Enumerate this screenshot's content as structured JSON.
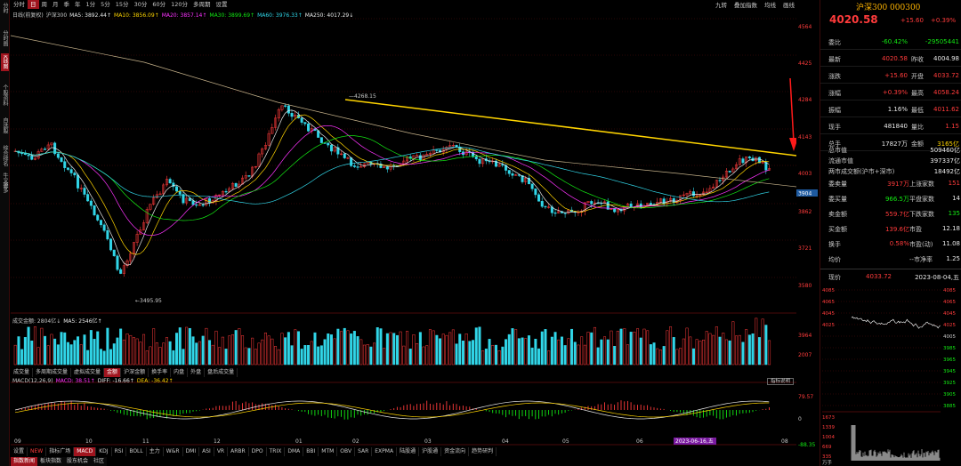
{
  "left_bar": [
    "分时",
    "分时图",
    "K线图",
    "个股资料",
    "自选股",
    "综合排名",
    "牛叉诊断",
    "更多"
  ],
  "period_tabs": [
    "分时",
    "日",
    "周",
    "月",
    "季",
    "年",
    "1分",
    "5分",
    "15分",
    "30分",
    "60分",
    "120分",
    "多周期",
    "设置"
  ],
  "period_active": 1,
  "toolbar_right": [
    "九转",
    "叠加指数",
    "均线",
    "画线"
  ],
  "ma_legend": [
    {
      "text": "日线(前复权)",
      "color": "#c8c8c8"
    },
    {
      "text": "沪深300",
      "color": "#c8c8c8"
    },
    {
      "text": "MA5: 3892.44↑",
      "color": "#e8e8e8"
    },
    {
      "text": "MA10: 3856.09↑",
      "color": "#ffd400"
    },
    {
      "text": "MA20: 3857.14↑",
      "color": "#ff33ff"
    },
    {
      "text": "MA30: 3899.69↑",
      "color": "#13e813"
    },
    {
      "text": "MA60: 3976.33↑",
      "color": "#31d6e8"
    },
    {
      "text": "MA250: 4017.29↓",
      "color": "#e8e8e8"
    }
  ],
  "price_axis": [
    "4564",
    "4425",
    "4284",
    "4143",
    "4003",
    "3862",
    "3721",
    "3580"
  ],
  "price_tags": {
    "current": "4003",
    "highlight": "3904"
  },
  "annotations": {
    "high": "4268.15",
    "low": "3495.95"
  },
  "vol_legend": [
    {
      "text": "成交金额: 2804亿↓",
      "color": "#c8c8c8"
    },
    {
      "text": "MA5: 2546亿↑",
      "color": "#e8e8e8"
    }
  ],
  "vol_axis": [
    "3964",
    "2007"
  ],
  "bottom_tabs_1": [
    "成交量",
    "多周期成交量",
    "虚拟成交量",
    "金额",
    "沪深金额",
    "换手率",
    "内盘",
    "外盘",
    "盘后成交量"
  ],
  "bottom_tabs_1_active": 3,
  "macd_legend": [
    {
      "text": "MACD(12,26,9)",
      "color": "#c8c8c8"
    },
    {
      "text": "MACD: 38.51↑",
      "color": "#ff33ff"
    },
    {
      "text": "DIFF: -16.66↑",
      "color": "#e8e8e8"
    },
    {
      "text": "DEA: -36.42↑",
      "color": "#ffd400"
    }
  ],
  "macd_axis": [
    "79.57",
    "0",
    "-88.35"
  ],
  "indicator_btn": "指标说明",
  "date_axis": [
    "09",
    "10",
    "11",
    "12",
    "01",
    "02",
    "03",
    "04",
    "05",
    "06",
    "07",
    "08"
  ],
  "date_highlight": "2023-06-16,五",
  "bottom_tabs_2": [
    "设置",
    "NEW",
    "指标广场",
    "MACD",
    "KDJ",
    "RSI",
    "BOLL",
    "主力",
    "W&R",
    "DMI",
    "ASI",
    "VR",
    "ARBR",
    "DPO",
    "TRIX",
    "DMA",
    "BBI",
    "MTM",
    "OBV",
    "SAR",
    "EXPMA",
    "陆股通",
    "沪股通",
    "资金流向",
    "趋势研判"
  ],
  "bottom_tabs_2_active": 3,
  "bottom_tabs_3": [
    "指数新闻",
    "板块指数",
    "股东机会",
    "社区"
  ],
  "bottom_tabs_3_active": 0,
  "quote": {
    "title": "沪深300 000300",
    "price": "4020.58",
    "change": "+15.60",
    "pct": "+0.39%",
    "rows": [
      {
        "k1": "委比",
        "v1": "-60.42%",
        "c1": "green",
        "k2": "",
        "v2": "-29505441",
        "c2": "green"
      },
      {
        "k1": "最新",
        "v1": "4020.58",
        "c1": "red",
        "k2": "昨收",
        "v2": "4004.98",
        "c2": "white"
      },
      {
        "k1": "涨跌",
        "v1": "+15.60",
        "c1": "red",
        "k2": "开盘",
        "v2": "4033.72",
        "c2": "red"
      },
      {
        "k1": "涨幅",
        "v1": "+0.39%",
        "c1": "red",
        "k2": "最高",
        "v2": "4058.24",
        "c2": "red"
      },
      {
        "k1": "振幅",
        "v1": "1.16%",
        "c1": "white",
        "k2": "最低",
        "v2": "4011.62",
        "c2": "red"
      },
      {
        "k1": "现手",
        "v1": "481840",
        "c1": "white",
        "k2": "量比",
        "v2": "1.15",
        "c2": "red"
      },
      {
        "k1": "总手",
        "v1": "17827万",
        "c1": "white",
        "k2": "金额",
        "v2": "3165亿",
        "c2": "yellow"
      }
    ],
    "section2": [
      {
        "k": "总市值",
        "v": "",
        "k2": "",
        "v2": "509460亿",
        "c": "white"
      },
      {
        "k": "流通市值",
        "v": "",
        "k2": "",
        "v2": "397337亿",
        "c": "white"
      },
      {
        "k": "两市成交额(沪市+深市)",
        "v": "",
        "k2": "",
        "v2": "18492亿",
        "c": "white"
      }
    ],
    "section3": [
      {
        "k": "委卖量",
        "v": "3917万",
        "k2": "上涨家数",
        "v2": "151",
        "c": "red",
        "c2": "red"
      },
      {
        "k": "委买量",
        "v": "966.5万",
        "k2": "平盘家数",
        "v2": "14",
        "c": "green",
        "c2": "white"
      },
      {
        "k": "卖金额",
        "v": "559.7亿",
        "k2": "下跌家数",
        "v2": "135",
        "c": "red",
        "c2": "green"
      },
      {
        "k": "买金额",
        "v": "139.6亿",
        "k2": "市盈",
        "v2": "12.18",
        "c": "red",
        "c2": "white"
      },
      {
        "k": "换手",
        "v": "0.58%",
        "k2": "市盈(动)",
        "v2": "11.08",
        "c": "red",
        "c2": "white"
      },
      {
        "k": "均价",
        "v": "",
        "k2": "--市净率",
        "v2": "1.25",
        "c": "white",
        "c2": "white"
      }
    ],
    "current_row": {
      "k": "现价",
      "v": "4033.72",
      "date": "2023-08-04,五"
    },
    "mini_axis": [
      "4085",
      "4065",
      "4045",
      "4025",
      "4005",
      "3985",
      "3965",
      "3945",
      "3925",
      "3905",
      "3885"
    ],
    "mini_vol": [
      "1673",
      "1339",
      "1004",
      "669",
      "335"
    ],
    "mini_vol_unit": "万手"
  }
}
